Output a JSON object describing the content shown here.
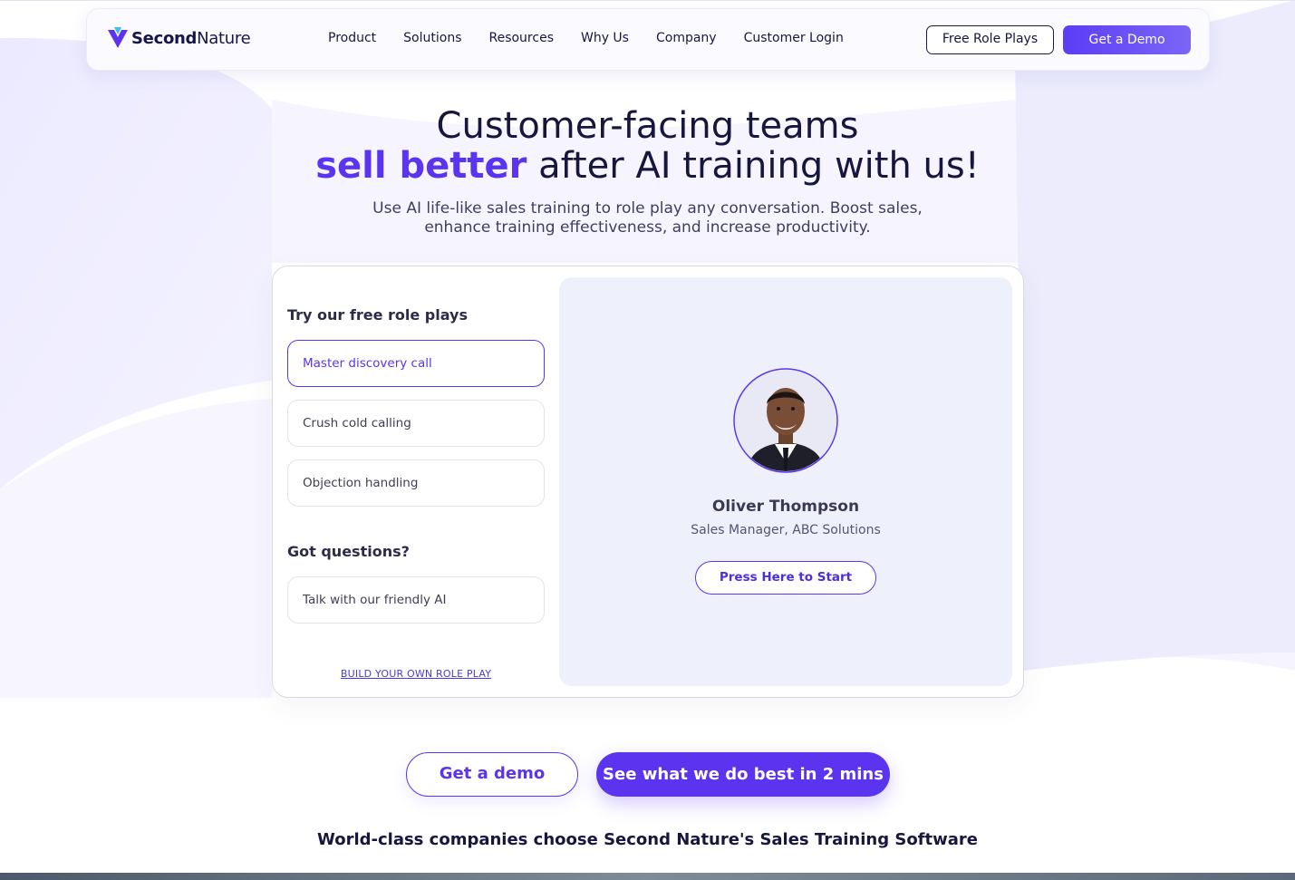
{
  "header": {
    "logo_text_bold": "Second",
    "logo_text_rest": "Nature",
    "nav": [
      "Product",
      "Solutions",
      "Resources",
      "Why Us",
      "Company",
      "Customer Login"
    ],
    "free_role_plays": "Free Role Plays",
    "get_demo": "Get a Demo"
  },
  "hero": {
    "line1": "Customer-facing teams",
    "highlight": "sell better",
    "line2_rest": " after AI training with us!",
    "sub_line1": "Use AI life-like sales training to role play any conversation. Boost sales,",
    "sub_line2": "enhance training effectiveness, and increase productivity."
  },
  "widget": {
    "left_title": "Try our free role plays",
    "options": [
      "Master discovery call",
      "Crush cold calling",
      "Objection handling"
    ],
    "questions_title": "Got questions?",
    "ai_option": "Talk with our friendly AI",
    "build_link": "BUILD YOUR OWN ROLE PLAY",
    "person_name": "Oliver Thompson",
    "person_role": "Sales Manager, ABC Solutions",
    "start_button": "Press Here to Start"
  },
  "cta": {
    "demo": "Get a demo",
    "video": "See what we do best in 2 mins"
  },
  "tagline": "World-class companies choose Second Nature's Sales Training Software",
  "colors": {
    "accent": "#5b34f0",
    "text_dark": "#16163f",
    "panel_bg": "#eef0fb"
  }
}
